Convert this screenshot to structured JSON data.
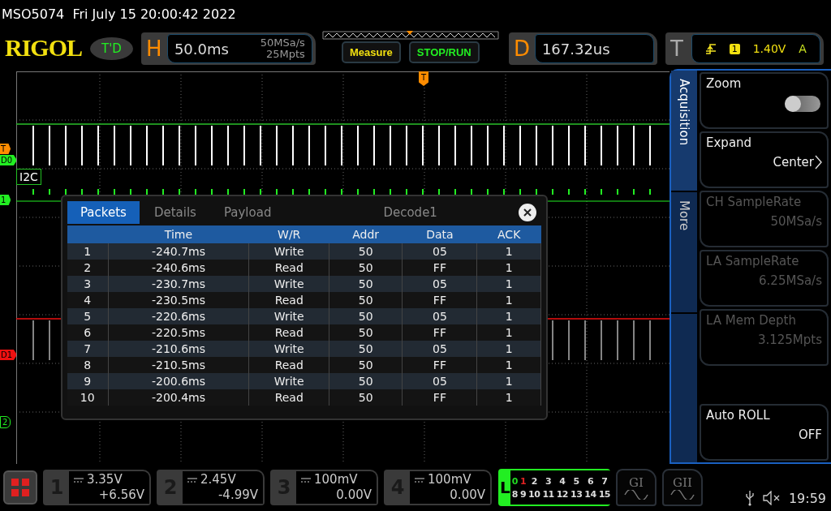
{
  "title": "MSO5074  Fri July 15 20:00:42 2022",
  "header": {
    "logo": "RIGOL",
    "status": "T'D",
    "horizontal": {
      "label": "H",
      "timebase": "50.0ms",
      "sample_rate": "50MSa/s",
      "memory_depth": "25Mpts"
    },
    "buttons": [
      {
        "label": "Measure",
        "kind": "measure"
      },
      {
        "label": "STOP/RUN",
        "kind": "run"
      }
    ],
    "delay": {
      "label": "D",
      "value": "167.32us"
    },
    "trigger": {
      "label": "T",
      "source": "1",
      "level": "1.40V",
      "mode": "A"
    }
  },
  "trigger_marker": "T",
  "channel_markers": [
    {
      "label": "T",
      "color": "#ff8c00",
      "kind": "filled"
    },
    {
      "label": "D0",
      "color": "#22ee22",
      "kind": "filled"
    },
    {
      "label": "1",
      "color": "#22ee22",
      "kind": "filled"
    },
    {
      "label": "D1",
      "color": "#ee1111",
      "kind": "filled"
    },
    {
      "label": "2",
      "color": "#22ee22",
      "kind": "outline"
    }
  ],
  "bus_label": "I2C",
  "decode_window": {
    "tabs": [
      {
        "label": "Packets",
        "selected": true
      },
      {
        "label": "Details",
        "selected": false
      },
      {
        "label": "Payload",
        "selected": false
      }
    ],
    "title": "Decode1",
    "columns": [
      "",
      "Time",
      "W/R",
      "Addr",
      "Data",
      "ACK"
    ],
    "rows": [
      [
        "1",
        "-240.7ms",
        "Write",
        "50",
        "05",
        "1"
      ],
      [
        "2",
        "-240.6ms",
        "Read",
        "50",
        "FF",
        "1"
      ],
      [
        "3",
        "-230.7ms",
        "Write",
        "50",
        "05",
        "1"
      ],
      [
        "4",
        "-230.5ms",
        "Read",
        "50",
        "FF",
        "1"
      ],
      [
        "5",
        "-220.6ms",
        "Write",
        "50",
        "05",
        "1"
      ],
      [
        "6",
        "-220.5ms",
        "Read",
        "50",
        "FF",
        "1"
      ],
      [
        "7",
        "-210.6ms",
        "Write",
        "50",
        "05",
        "1"
      ],
      [
        "8",
        "-210.5ms",
        "Read",
        "50",
        "FF",
        "1"
      ],
      [
        "9",
        "-200.6ms",
        "Write",
        "50",
        "05",
        "1"
      ],
      [
        "10",
        "-200.4ms",
        "Read",
        "50",
        "FF",
        "1"
      ]
    ]
  },
  "side_menu": {
    "tabs": [
      {
        "label": "Acquisition",
        "selected": true
      },
      {
        "label": "More",
        "selected": false
      }
    ],
    "items": [
      {
        "kind": "toggle",
        "label": "Zoom",
        "on": false,
        "disabled": false
      },
      {
        "kind": "value",
        "label": "Expand",
        "value": "Center",
        "arrow": true,
        "disabled": false
      },
      {
        "kind": "value",
        "label": "CH SampleRate",
        "value": "50MSa/s",
        "arrow": false,
        "disabled": true
      },
      {
        "kind": "value",
        "label": "LA SampleRate",
        "value": "6.25MSa/s",
        "arrow": false,
        "disabled": true
      },
      {
        "kind": "value",
        "label": "LA Mem Depth",
        "value": "3.125Mpts",
        "arrow": false,
        "disabled": true
      },
      {
        "kind": "value",
        "label": "Auto ROLL",
        "value": "OFF",
        "arrow": false,
        "disabled": false
      }
    ]
  },
  "channels": [
    {
      "number": "1",
      "scale": "3.35V",
      "offset": "+6.56V"
    },
    {
      "number": "2",
      "scale": "2.45V",
      "offset": "-4.99V"
    },
    {
      "number": "3",
      "scale": "100mV",
      "offset": "0.00V"
    },
    {
      "number": "4",
      "scale": "100mV",
      "offset": "0.00V"
    }
  ],
  "logic": {
    "label": "L",
    "channels": [
      {
        "label": "0",
        "color": "#22dd22"
      },
      {
        "label": "1",
        "color": "#dd2222"
      },
      {
        "label": "2",
        "color": "#dddddd"
      },
      {
        "label": "3",
        "color": "#dddddd"
      },
      {
        "label": "4",
        "color": "#dddddd"
      },
      {
        "label": "5",
        "color": "#dddddd"
      },
      {
        "label": "6",
        "color": "#dddddd"
      },
      {
        "label": "7",
        "color": "#dddddd"
      },
      {
        "label": "8",
        "color": "#dddddd"
      },
      {
        "label": "9",
        "color": "#dddddd"
      },
      {
        "label": "10",
        "color": "#dddddd"
      },
      {
        "label": "11",
        "color": "#dddddd"
      },
      {
        "label": "12",
        "color": "#dddddd"
      },
      {
        "label": "13",
        "color": "#dddddd"
      },
      {
        "label": "14",
        "color": "#dddddd"
      },
      {
        "label": "15",
        "color": "#dddddd"
      }
    ]
  },
  "generators": [
    "GI",
    "GII"
  ],
  "clock": "19:59"
}
